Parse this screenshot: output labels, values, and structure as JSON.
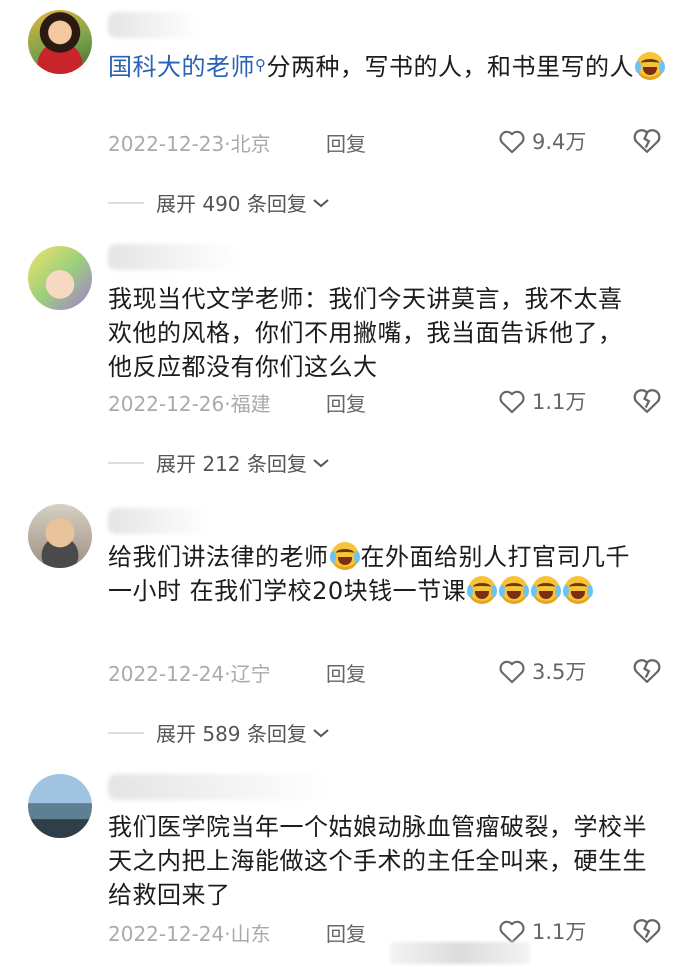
{
  "comments": [
    {
      "mention": "国科大的老师",
      "text": "分两种，写书的人，和书里写的人",
      "date_location": "2022-12-23·北京",
      "reply_label": "回复",
      "likes": "9.4万",
      "expand_label": "展开 490 条回复"
    },
    {
      "text": "我现当代文学老师：我们今天讲莫言，我不太喜欢他的风格，你们不用撇嘴，我当面告诉他了，他反应都没有你们这么大",
      "date_location": "2022-12-26·福建",
      "reply_label": "回复",
      "likes": "1.1万",
      "expand_label": "展开 212 条回复"
    },
    {
      "text_a": "给我们讲法律的老师",
      "text_b": "在外面给别人打官司几千一小时 在我们学校20块钱一节课",
      "date_location": "2022-12-24·辽宁",
      "reply_label": "回复",
      "likes": "3.5万",
      "expand_label": "展开 589 条回复"
    },
    {
      "text": "我们医学院当年一个姑娘动脉血管瘤破裂，学校半天之内把上海能做这个手术的主任全叫来，硬生生给救回来了",
      "date_location": "2022-12-24·山东",
      "reply_label": "回复",
      "likes": "1.1万"
    }
  ],
  "icons": {
    "like": "heart-outline-icon",
    "dislike": "broken-heart-icon",
    "expand": "chevron-down-icon",
    "mention": "search-icon",
    "emoji": "laugh-cry-emoji-icon"
  }
}
